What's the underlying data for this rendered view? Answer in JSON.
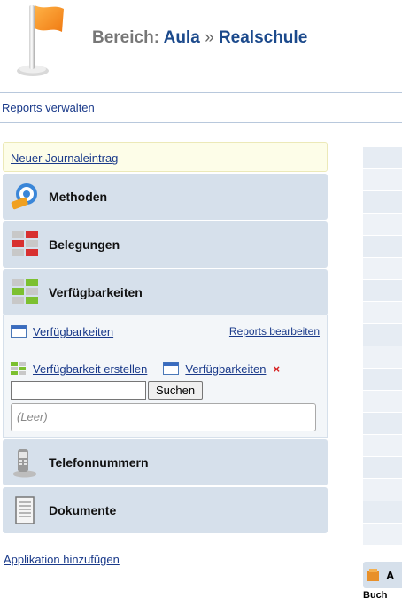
{
  "header": {
    "prefix": "Bereich:",
    "area": "Aula",
    "separator": "»",
    "subarea": "Realschule"
  },
  "reports_link": "Reports verwalten",
  "sidebar": {
    "journal_link": "Neuer Journaleintrag",
    "sections": [
      {
        "label": "Methoden",
        "icon": "methods-icon"
      },
      {
        "label": "Belegungen",
        "icon": "bookings-icon"
      },
      {
        "label": "Verfügbarkeiten",
        "icon": "availability-icon"
      }
    ],
    "expanded": {
      "report_link": "Verfügbarkeiten",
      "edit_reports": "Reports bearbeiten",
      "create_link": "Verfügbarkeit erstellen",
      "list_link": "Verfügbarkeiten",
      "delete_symbol": "×",
      "search_value": "",
      "search_button": "Suchen",
      "empty_text": "(Leer)"
    },
    "sections_after": [
      {
        "label": "Telefonnummern",
        "icon": "phone-icon"
      },
      {
        "label": "Dokumente",
        "icon": "document-icon"
      }
    ]
  },
  "add_app_link": "Applikation hinzufügen",
  "right_panel": {
    "label": "A",
    "below": "Buch"
  },
  "colors": {
    "section_bg": "#d6e0eb",
    "link": "#1a3a8a",
    "title_area": "#1c4a8c",
    "journal_bg": "#fdfde8",
    "delete": "#d62020"
  }
}
